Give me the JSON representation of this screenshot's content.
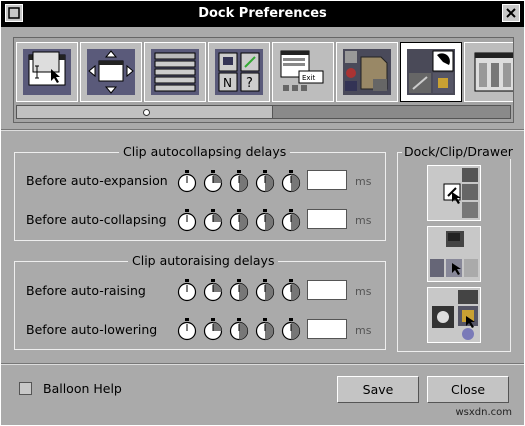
{
  "window": {
    "title": "Dock Preferences"
  },
  "toolbar": {
    "tiles": [
      {
        "icon": "window-focus-icon"
      },
      {
        "icon": "window-placement-icon"
      },
      {
        "icon": "window-list-icon"
      },
      {
        "icon": "icon-preferences-icon"
      },
      {
        "icon": "workspace-menu-icon"
      },
      {
        "icon": "application-paths-icon"
      },
      {
        "icon": "dock-clip-icon",
        "selected": true
      },
      {
        "icon": "more-preferences-icon"
      }
    ]
  },
  "collapse_group": {
    "title": "Clip autocollapsing delays",
    "rows": [
      {
        "label": "Before auto-expansion",
        "value": "",
        "unit": "ms"
      },
      {
        "label": "Before auto-collapsing",
        "value": "",
        "unit": "ms"
      }
    ]
  },
  "raise_group": {
    "title": "Clip autoraising delays",
    "rows": [
      {
        "label": "Before auto-raising",
        "value": "",
        "unit": "ms"
      },
      {
        "label": "Before auto-lowering",
        "value": "",
        "unit": "ms"
      }
    ]
  },
  "dock_group": {
    "title": "Dock/Clip/Drawer"
  },
  "balloon": {
    "label": "Balloon Help",
    "checked": false
  },
  "buttons": {
    "save": "Save",
    "close": "Close"
  },
  "watermark": "wsxdn.com"
}
